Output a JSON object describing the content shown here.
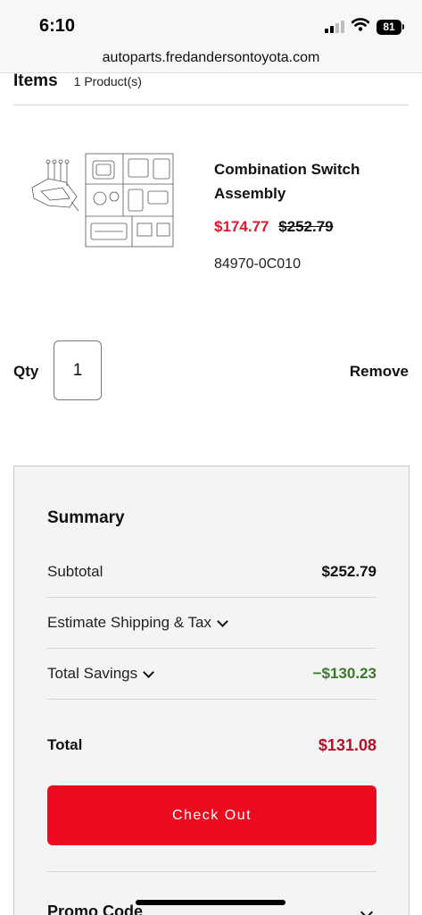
{
  "status_bar": {
    "time": "6:10",
    "battery": "81"
  },
  "browser": {
    "url": "autoparts.fredandersontoyota.com"
  },
  "items": {
    "title": "Items",
    "count_label": "1 Product(s)"
  },
  "product": {
    "name": "Combination Switch Assembly",
    "sale_price": "$174.77",
    "original_price": "$252.79",
    "part_number": "84970-0C010"
  },
  "qty": {
    "label": "Qty",
    "value": "1"
  },
  "remove_label": "Remove",
  "summary": {
    "title": "Summary",
    "subtotal_label": "Subtotal",
    "subtotal_value": "$252.79",
    "shipping_label": "Estimate Shipping & Tax",
    "savings_label": "Total Savings",
    "savings_value": "−$130.23",
    "total_label": "Total",
    "total_value": "$131.08",
    "checkout_label": "Check Out",
    "promo_label": "Promo Code"
  },
  "colors": {
    "accent": "#eb0a1e",
    "sale_price": "#e0182d",
    "savings": "#3b7a2a",
    "total": "#b0122a"
  },
  "icons": [
    "signal-icon",
    "wifi-icon",
    "battery-icon",
    "chevron-down-icon"
  ]
}
